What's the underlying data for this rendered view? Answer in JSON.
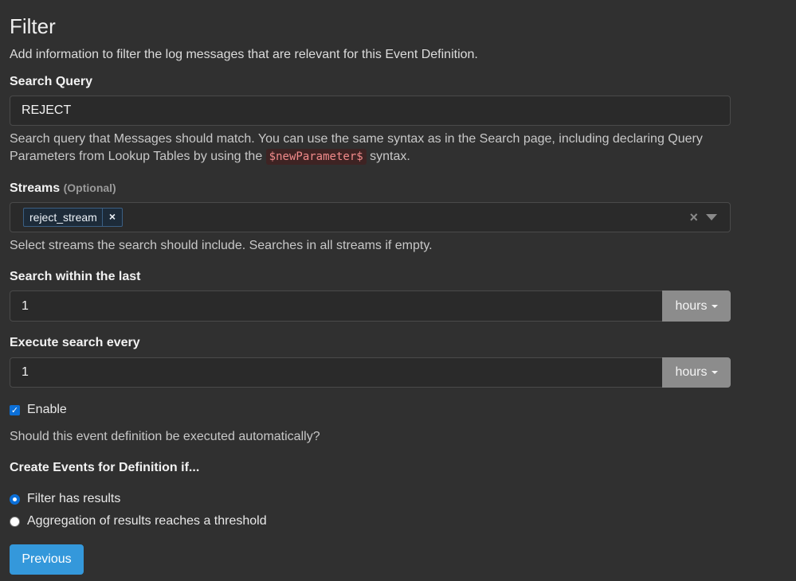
{
  "section": {
    "title": "Filter",
    "description": "Add information to filter the log messages that are relevant for this Event Definition."
  },
  "search_query": {
    "label": "Search Query",
    "value": "REJECT",
    "help_before": "Search query that Messages should match. You can use the same syntax as in the Search page, including declaring Query Parameters from Lookup Tables by using the",
    "help_code": "$newParameter$",
    "help_after": "syntax."
  },
  "streams": {
    "label": "Streams",
    "optional": "(Optional)",
    "selected": [
      "reject_stream"
    ],
    "remove_glyph": "×",
    "clear_glyph": "×",
    "help": "Select streams the search should include. Searches in all streams if empty."
  },
  "search_within": {
    "label": "Search within the last",
    "value": "1",
    "unit": "hours"
  },
  "execute_every": {
    "label": "Execute search every",
    "value": "1",
    "unit": "hours"
  },
  "enable": {
    "label": "Enable",
    "checked": true,
    "check_glyph": "✓",
    "help": "Should this event definition be executed automatically?"
  },
  "create_events": {
    "label": "Create Events for Definition if...",
    "options": [
      {
        "label": "Filter has results",
        "selected": true
      },
      {
        "label": "Aggregation of results reaches a threshold",
        "selected": false
      }
    ]
  },
  "buttons": {
    "previous": "Previous"
  },
  "colors": {
    "background": "#303030",
    "accent": "#3498db",
    "addon": "#8c8c8c"
  }
}
